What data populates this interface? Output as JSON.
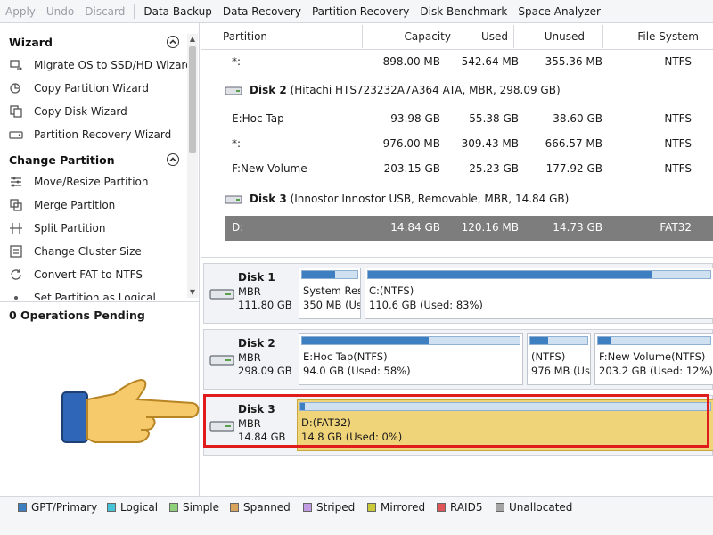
{
  "toolbar": {
    "apply": "Apply",
    "undo": "Undo",
    "discard": "Discard",
    "data_backup": "Data Backup",
    "data_recovery": "Data Recovery",
    "partition_recovery": "Partition Recovery",
    "disk_benchmark": "Disk Benchmark",
    "space_analyzer": "Space Analyzer"
  },
  "sidebar": {
    "wizard_title": "Wizard",
    "wizard_items": [
      {
        "label": "Migrate OS to SSD/HD Wizard",
        "icon": "migrate-os-icon"
      },
      {
        "label": "Copy Partition Wizard",
        "icon": "copy-partition-icon"
      },
      {
        "label": "Copy Disk Wizard",
        "icon": "copy-disk-icon"
      },
      {
        "label": "Partition Recovery Wizard",
        "icon": "partition-recovery-icon"
      }
    ],
    "change_title": "Change Partition",
    "change_items": [
      {
        "label": "Move/Resize Partition",
        "icon": "move-resize-icon"
      },
      {
        "label": "Merge Partition",
        "icon": "merge-icon"
      },
      {
        "label": "Split Partition",
        "icon": "split-icon"
      },
      {
        "label": "Change Cluster Size",
        "icon": "cluster-size-icon"
      },
      {
        "label": "Convert FAT to NTFS",
        "icon": "convert-icon"
      },
      {
        "label": "Set Partition as Logical",
        "icon": "logical-icon"
      }
    ],
    "operations_pending": "0 Operations Pending"
  },
  "table": {
    "columns": [
      "Partition",
      "Capacity",
      "Used",
      "Unused",
      "File System"
    ],
    "rows": [
      {
        "kind": "part",
        "partition": "*:",
        "capacity": "898.00 MB",
        "used": "542.64 MB",
        "unused": "355.36 MB",
        "fs": "NTFS"
      },
      {
        "kind": "disk",
        "name": "Disk 2",
        "desc": "(Hitachi HTS723232A7A364 ATA, MBR, 298.09 GB)"
      },
      {
        "kind": "part",
        "partition": "E:Hoc Tap",
        "capacity": "93.98 GB",
        "used": "55.38 GB",
        "unused": "38.60 GB",
        "fs": "NTFS"
      },
      {
        "kind": "part",
        "partition": "*:",
        "capacity": "976.00 MB",
        "used": "309.43 MB",
        "unused": "666.57 MB",
        "fs": "NTFS"
      },
      {
        "kind": "part",
        "partition": "F:New Volume",
        "capacity": "203.15 GB",
        "used": "25.23 GB",
        "unused": "177.92 GB",
        "fs": "NTFS"
      },
      {
        "kind": "disk",
        "name": "Disk 3",
        "desc": "(Innostor Innostor USB, Removable, MBR, 14.84 GB)"
      },
      {
        "kind": "part",
        "selected": true,
        "partition": "D:",
        "capacity": "14.84 GB",
        "used": "120.16 MB",
        "unused": "14.73 GB",
        "fs": "FAT32"
      }
    ]
  },
  "disks": [
    {
      "name": "Disk 1",
      "type": "MBR",
      "size": "111.80 GB",
      "partitions": [
        {
          "l1": "System Rese",
          "l2": "350 MB (Use",
          "used_fraction": 0.6
        },
        {
          "l1": "C:(NTFS)",
          "l2": "110.6 GB (Used: 83%)",
          "used_fraction": 0.83
        }
      ]
    },
    {
      "name": "Disk 2",
      "type": "MBR",
      "size": "298.09 GB",
      "partitions": [
        {
          "l1": "E:Hoc Tap(NTFS)",
          "l2": "94.0 GB (Used: 58%)",
          "used_fraction": 0.58
        },
        {
          "l1": "(NTFS)",
          "l2": "976 MB (Use",
          "used_fraction": 0.32
        },
        {
          "l1": "F:New Volume(NTFS)",
          "l2": "203.2 GB (Used: 12%)",
          "used_fraction": 0.12
        }
      ]
    },
    {
      "name": "Disk 3",
      "type": "MBR",
      "size": "14.84 GB",
      "partitions": [
        {
          "l1": "D:(FAT32)",
          "l2": "14.8 GB (Used: 0%)",
          "used_fraction": 0.01
        }
      ]
    }
  ],
  "legend": [
    {
      "label": "GPT/Primary",
      "color": "#3d7fc0"
    },
    {
      "label": "Logical",
      "color": "#46c3d6"
    },
    {
      "label": "Simple",
      "color": "#8fd17a"
    },
    {
      "label": "Spanned",
      "color": "#d8a35a"
    },
    {
      "label": "Striped",
      "color": "#c39be0"
    },
    {
      "label": "Mirrored",
      "color": "#c9c93a"
    },
    {
      "label": "RAID5",
      "color": "#e05656"
    },
    {
      "label": "Unallocated",
      "color": "#a5a5a5"
    }
  ],
  "colors": {
    "highlight": "#e01b1b",
    "selected_partition": "#f0d47a",
    "selected_row": "#7d7d7d"
  }
}
